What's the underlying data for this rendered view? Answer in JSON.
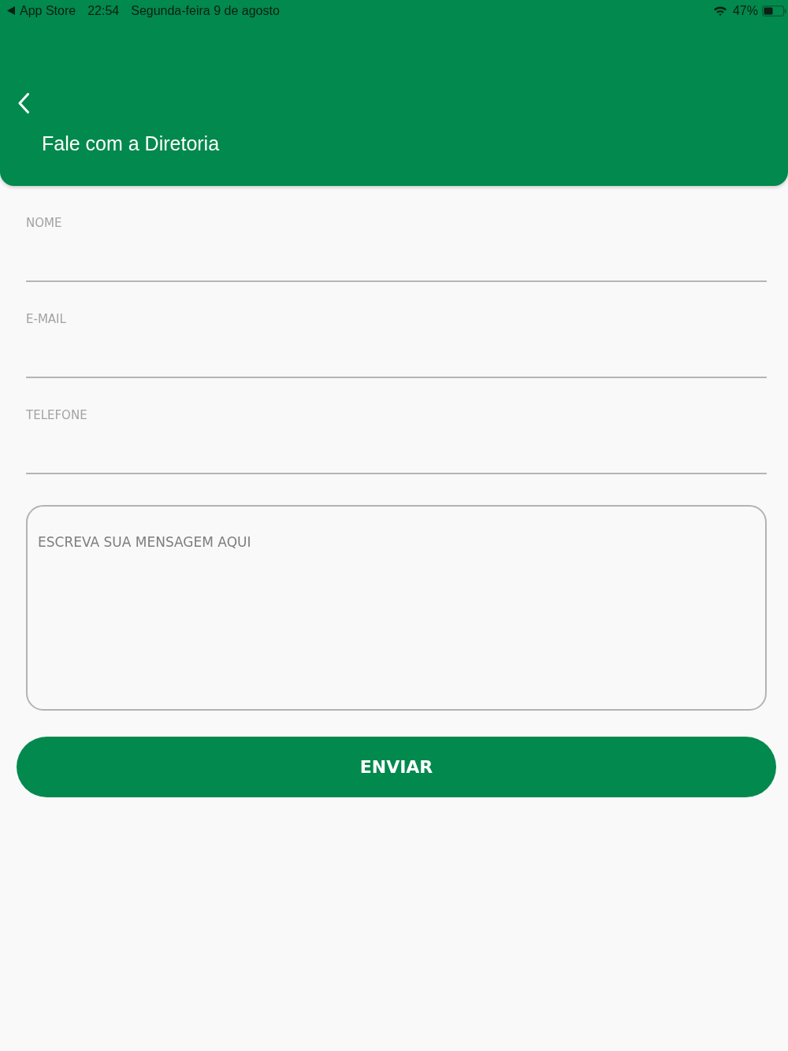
{
  "status_bar": {
    "back_label": "App Store",
    "time": "22:54",
    "date": "Segunda-feira 9 de agosto",
    "battery": "47%"
  },
  "header": {
    "title": "Fale com a Diretoria"
  },
  "fields": [
    {
      "placeholder": "NOME"
    },
    {
      "placeholder": "E-MAIL"
    },
    {
      "placeholder": "TELEFONE"
    }
  ],
  "message": {
    "placeholder": "ESCREVA SUA MENSAGEM AQUI"
  },
  "submit_button": {
    "label": "ENVIAR"
  }
}
